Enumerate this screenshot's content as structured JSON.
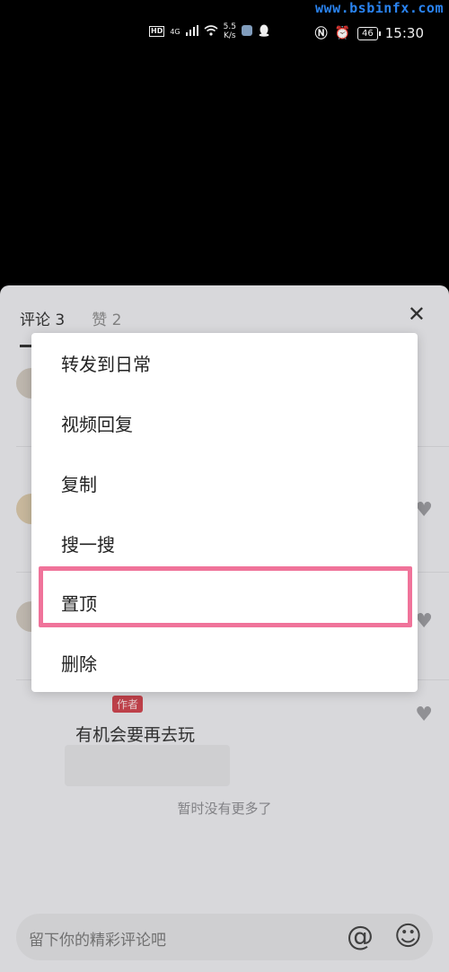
{
  "status_bar": {
    "watermark": "www.bsbinfx.com",
    "hd": "HD",
    "network": "4G",
    "speed_value": "5.5",
    "speed_unit": "K/s",
    "battery": "46",
    "time": "15:30"
  },
  "sheet": {
    "tabs": [
      {
        "label": "评论 3"
      },
      {
        "label": "赞 2"
      }
    ],
    "close_icon": "close-icon",
    "author_tag": "作者",
    "comment_text": "有机会要再去玩",
    "no_more_text": "暂时没有更多了",
    "input_placeholder": "留下你的精彩评论吧",
    "at_symbol": "@",
    "emoji_symbol": "☺"
  },
  "menu": {
    "items": [
      {
        "label": "转发到日常"
      },
      {
        "label": "视频回复"
      },
      {
        "label": "复制"
      },
      {
        "label": "搜一搜"
      },
      {
        "label": "置顶"
      },
      {
        "label": "删除"
      }
    ]
  },
  "colors": {
    "highlight": "#f0739a",
    "author_tag": "#c9454e",
    "watermark": "#2d8cff"
  }
}
